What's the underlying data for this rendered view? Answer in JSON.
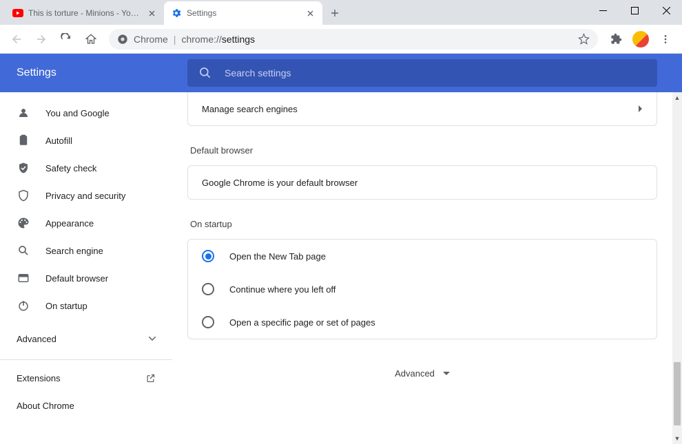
{
  "tabs": [
    {
      "title": "This is torture - Minions - YouTube",
      "favicon": "youtube"
    },
    {
      "title": "Settings",
      "favicon": "gear"
    }
  ],
  "omnibox": {
    "origin": "Chrome",
    "path": "chrome://settings"
  },
  "settings_title": "Settings",
  "search_placeholder": "Search settings",
  "sidebar": {
    "items": [
      {
        "label": "You and Google"
      },
      {
        "label": "Autofill"
      },
      {
        "label": "Safety check"
      },
      {
        "label": "Privacy and security"
      },
      {
        "label": "Appearance"
      },
      {
        "label": "Search engine"
      },
      {
        "label": "Default browser"
      },
      {
        "label": "On startup"
      }
    ],
    "advanced": "Advanced",
    "extensions": "Extensions",
    "about": "About Chrome"
  },
  "main": {
    "manage_search": "Manage search engines",
    "default_browser_heading": "Default browser",
    "default_browser_text": "Google Chrome is your default browser",
    "on_startup_heading": "On startup",
    "startup_options": [
      {
        "label": "Open the New Tab page",
        "checked": true
      },
      {
        "label": "Continue where you left off",
        "checked": false
      },
      {
        "label": "Open a specific page or set of pages",
        "checked": false
      }
    ],
    "advanced": "Advanced"
  }
}
